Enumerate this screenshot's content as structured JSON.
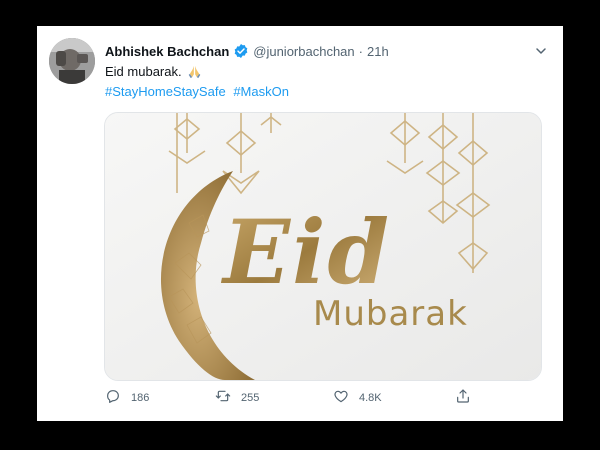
{
  "tweet": {
    "author_name": "Abhishek Bachchan",
    "handle": "@juniorbachchan",
    "separator": "·",
    "time": "21h",
    "text": "Eid mubarak.",
    "hashtags": [
      "#StayHomeStaySafe",
      "#MaskOn"
    ],
    "media": {
      "title_word": "Eid",
      "subtitle_word": "Mubarak"
    },
    "actions": {
      "replies": "186",
      "retweets": "255",
      "likes": "4.8K"
    }
  },
  "colors": {
    "link": "#1d9bf0",
    "muted": "#536471",
    "gold": "#a88a4c"
  },
  "icons": [
    "verified-badge-icon",
    "chevron-down-icon",
    "folded-hands-icon",
    "reply-icon",
    "retweet-icon",
    "like-icon",
    "share-icon"
  ]
}
